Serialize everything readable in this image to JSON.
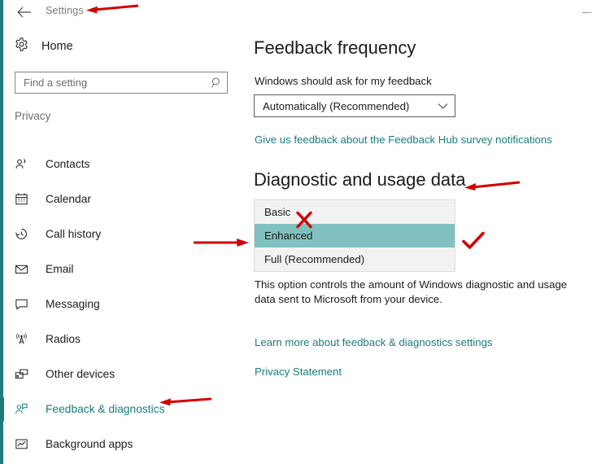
{
  "window": {
    "title": "Settings",
    "back_icon": "back-arrow-icon",
    "minimize_icon": "minimize-icon"
  },
  "sidebar": {
    "home": {
      "label": "Home",
      "icon": "gear-icon"
    },
    "search": {
      "placeholder": "Find a setting",
      "value": "",
      "icon": "search-icon"
    },
    "group_label": "Privacy",
    "items": [
      {
        "label": "Contacts",
        "icon": "contacts-icon",
        "selected": false
      },
      {
        "label": "Calendar",
        "icon": "calendar-icon",
        "selected": false
      },
      {
        "label": "Call history",
        "icon": "call-history-icon",
        "selected": false
      },
      {
        "label": "Email",
        "icon": "email-icon",
        "selected": false
      },
      {
        "label": "Messaging",
        "icon": "messaging-icon",
        "selected": false
      },
      {
        "label": "Radios",
        "icon": "radios-icon",
        "selected": false
      },
      {
        "label": "Other devices",
        "icon": "other-devices-icon",
        "selected": false
      },
      {
        "label": "Feedback & diagnostics",
        "icon": "feedback-diagnostics-icon",
        "selected": true
      },
      {
        "label": "Background apps",
        "icon": "background-apps-icon",
        "selected": false
      }
    ]
  },
  "main": {
    "feedback_frequency": {
      "heading": "Feedback frequency",
      "subtitle": "Windows should ask for my feedback",
      "select_value": "Automatically (Recommended)",
      "select_icon": "chevron-down-icon",
      "link": "Give us feedback about the Feedback Hub survey notifications"
    },
    "diagnostic_usage": {
      "heading": "Diagnostic and usage data",
      "options": [
        {
          "label": "Basic",
          "highlighted": false
        },
        {
          "label": "Enhanced",
          "highlighted": true
        },
        {
          "label": "Full (Recommended)",
          "highlighted": false
        }
      ],
      "description": "This option controls the amount of Windows diagnostic and usage data sent to Microsoft from your device.",
      "learn_more_link": "Learn more about feedback & diagnostics settings",
      "privacy_link": "Privacy Statement"
    }
  },
  "annotations": {
    "arrow_to_title": "red-arrow-left-icon",
    "arrow_to_diagnostic_heading": "red-arrow-left-icon",
    "arrow_to_enhanced_option": "red-arrow-right-icon",
    "arrow_to_feedback_nav": "red-arrow-left-icon",
    "x_mark_on_basic": "red-x-icon",
    "check_mark_on_enhanced": "red-check-icon"
  },
  "colors": {
    "accent_teal": "#1d7b7b",
    "highlight_teal": "#81c0c0",
    "annotation_red": "#d40000",
    "text": "#1b1b1b",
    "muted_text": "#6e6e6e"
  }
}
